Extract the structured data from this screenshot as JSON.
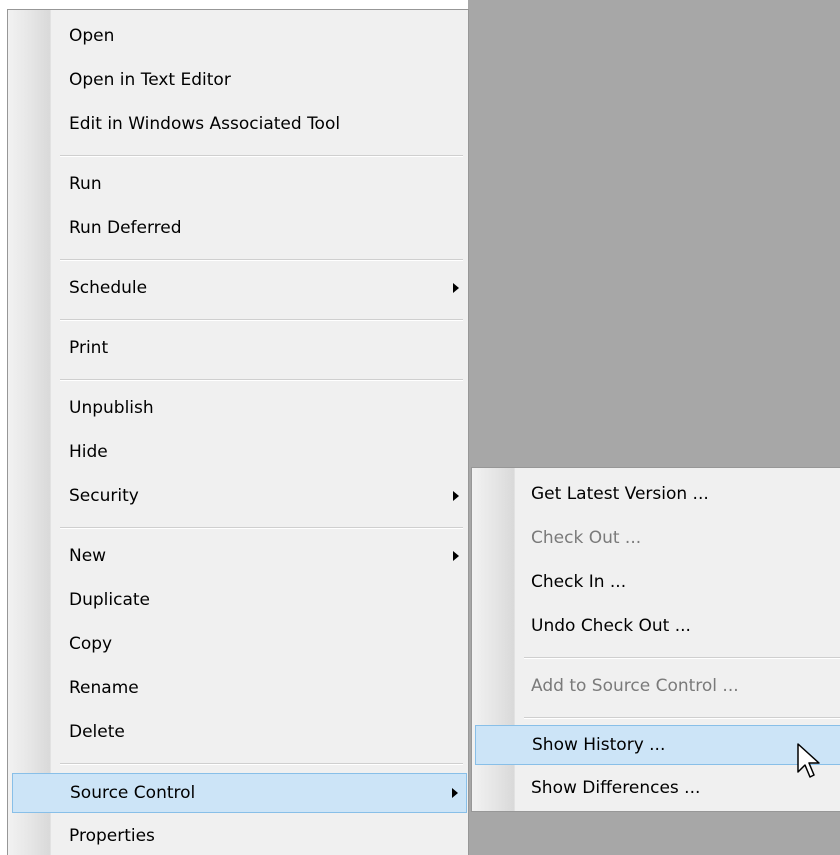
{
  "context_menu": {
    "items": [
      {
        "label": "Open"
      },
      {
        "label": "Open in Text Editor"
      },
      {
        "label": "Edit in Windows Associated Tool"
      },
      {
        "label": "Run"
      },
      {
        "label": "Run Deferred"
      },
      {
        "label": "Schedule",
        "submenu": true
      },
      {
        "label": "Print"
      },
      {
        "label": "Unpublish"
      },
      {
        "label": "Hide"
      },
      {
        "label": "Security",
        "submenu": true
      },
      {
        "label": "New",
        "submenu": true
      },
      {
        "label": "Duplicate"
      },
      {
        "label": "Copy"
      },
      {
        "label": "Rename"
      },
      {
        "label": "Delete"
      },
      {
        "label": "Source Control",
        "submenu": true,
        "highlighted": true
      },
      {
        "label": "Properties"
      }
    ]
  },
  "source_control_submenu": {
    "items": [
      {
        "label": "Get Latest Version ..."
      },
      {
        "label": "Check Out ...",
        "disabled": true
      },
      {
        "label": "Check In ..."
      },
      {
        "label": "Undo Check Out ..."
      },
      {
        "label": "Add to Source Control ...",
        "disabled": true
      },
      {
        "label": "Show History ...",
        "highlighted": true
      },
      {
        "label": "Show Differences ..."
      }
    ]
  },
  "colors": {
    "highlight_fill": "#cce4f7",
    "highlight_border": "#88bfe8",
    "menu_background": "#f0f0f0",
    "desktop_background": "#a7a7a7",
    "disabled_text": "#7a7a7a"
  },
  "icons": {
    "submenu_arrow": "triangle-right",
    "cursor": "arrow-pointer"
  }
}
